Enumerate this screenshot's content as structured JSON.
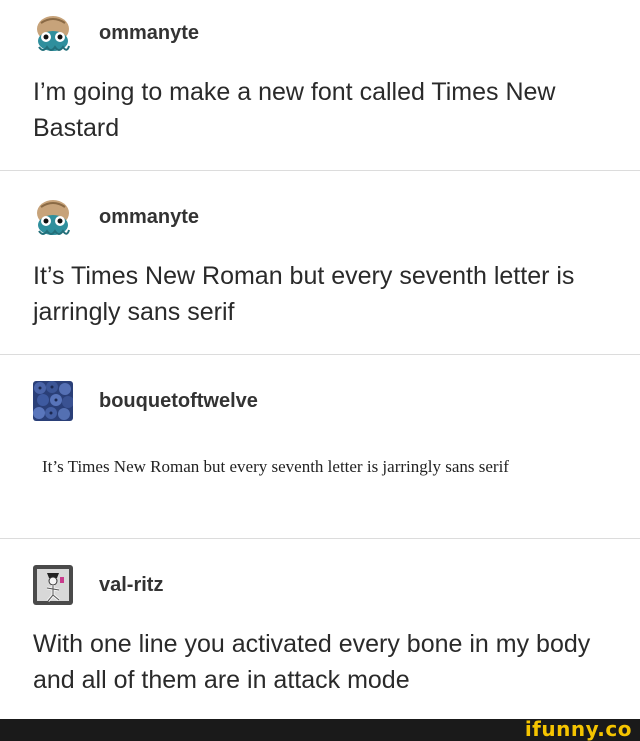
{
  "posts": [
    {
      "username": "ommanyte",
      "text": "I’m going to make a new font called Times New Bastard",
      "avatar": "octopus-avatar"
    },
    {
      "username": "ommanyte",
      "text": "It’s Times New Roman but every seventh letter is jarringly sans serif",
      "avatar": "octopus-avatar"
    },
    {
      "username": "bouquetoftwelve",
      "text": "It’s Times New Roman but every seventh letter is jarringly sans serif",
      "avatar": "blueberries-avatar"
    },
    {
      "username": "val-ritz",
      "text": "With one line you activated every bone in my body and all of them are in attack mode",
      "avatar": "skeleton-avatar"
    }
  ],
  "watermark": "ifunny.co",
  "colors": {
    "divider": "#dcdcdc",
    "watermark": "#f5c400",
    "bottom_bar": "#1a1a1a"
  }
}
